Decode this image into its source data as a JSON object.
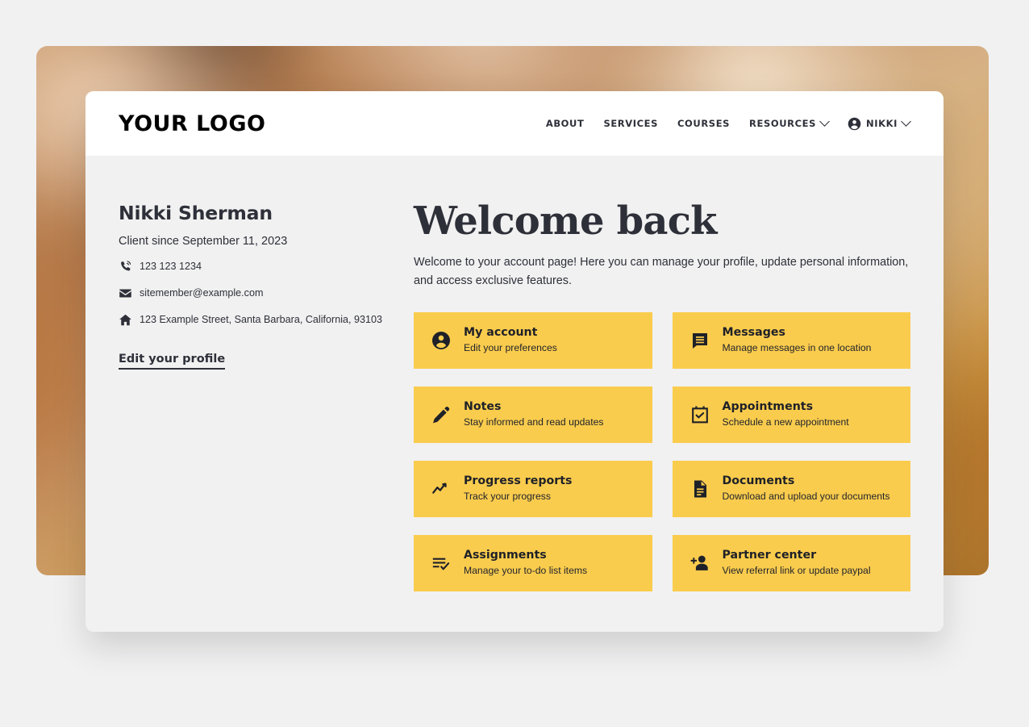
{
  "header": {
    "logo": "YOUR LOGO",
    "nav": [
      {
        "label": "ABOUT",
        "has_chevron": false,
        "icon": null
      },
      {
        "label": "SERVICES",
        "has_chevron": false,
        "icon": null
      },
      {
        "label": "COURSES",
        "has_chevron": false,
        "icon": null
      },
      {
        "label": "RESOURCES",
        "has_chevron": true,
        "icon": null
      },
      {
        "label": "NIKKI",
        "has_chevron": true,
        "icon": "account-circle-icon"
      }
    ]
  },
  "sidebar": {
    "name": "Nikki Sherman",
    "client_since": "Client since September 11, 2023",
    "phone": "123 123 1234",
    "email": "sitemember@example.com",
    "address": "123 Example Street, Santa Barbara, California, 93103",
    "edit_profile_label": "Edit your profile",
    "icons": {
      "phone": "phone-ring-icon",
      "email": "envelope-icon",
      "address": "home-icon"
    }
  },
  "main": {
    "title": "Welcome back",
    "description": "Welcome to your account page! Here you can manage your profile, update personal information, and access exclusive features.",
    "cards": [
      {
        "title": "My account",
        "desc": "Edit your preferences",
        "icon": "account-circle-icon"
      },
      {
        "title": "Messages",
        "desc": "Manage messages in one location",
        "icon": "chat-bubble-icon"
      },
      {
        "title": "Notes",
        "desc": "Stay informed and read updates",
        "icon": "pencil-icon"
      },
      {
        "title": "Appointments",
        "desc": "Schedule a new appointment",
        "icon": "calendar-check-icon"
      },
      {
        "title": "Progress reports",
        "desc": "Track your progress",
        "icon": "trending-line-icon"
      },
      {
        "title": "Documents",
        "desc": "Download and upload your documents",
        "icon": "document-icon"
      },
      {
        "title": "Assignments",
        "desc": "Manage your to-do list items",
        "icon": "list-check-icon"
      },
      {
        "title": "Partner center",
        "desc": "View referral link or update paypal",
        "icon": "person-add-icon"
      }
    ]
  },
  "colors": {
    "card_yellow": "#FACC4D",
    "text_dark": "#2E3039",
    "panel_bg": "#F1F1F1",
    "header_bg": "#FFFFFF",
    "page_bg": "#F1F1F2"
  }
}
